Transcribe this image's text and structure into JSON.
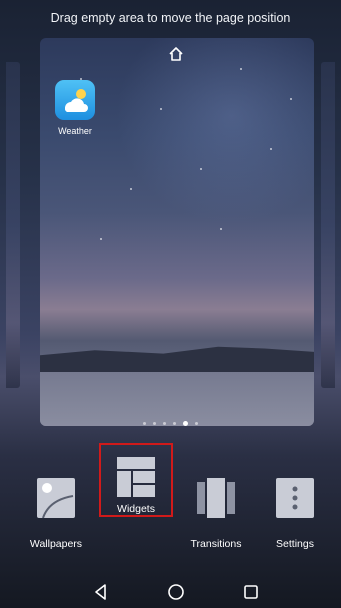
{
  "hint": "Drag empty area to move the page position",
  "home_screen": {
    "apps": [
      {
        "name": "Weather",
        "icon": "weather-icon"
      }
    ]
  },
  "page_indicator": {
    "count": 6,
    "active": 4
  },
  "toolbar": {
    "items": [
      {
        "label": "Wallpapers",
        "icon": "wallpaper-icon"
      },
      {
        "label": "Widgets",
        "icon": "widgets-icon",
        "selected": true
      },
      {
        "label": "Transitions",
        "icon": "transitions-icon"
      },
      {
        "label": "Settings",
        "icon": "settings-icon"
      }
    ],
    "highlight_color": "#d11a1a"
  },
  "navigation": {
    "back": "back-icon",
    "home": "home-icon",
    "recents": "recents-icon"
  }
}
